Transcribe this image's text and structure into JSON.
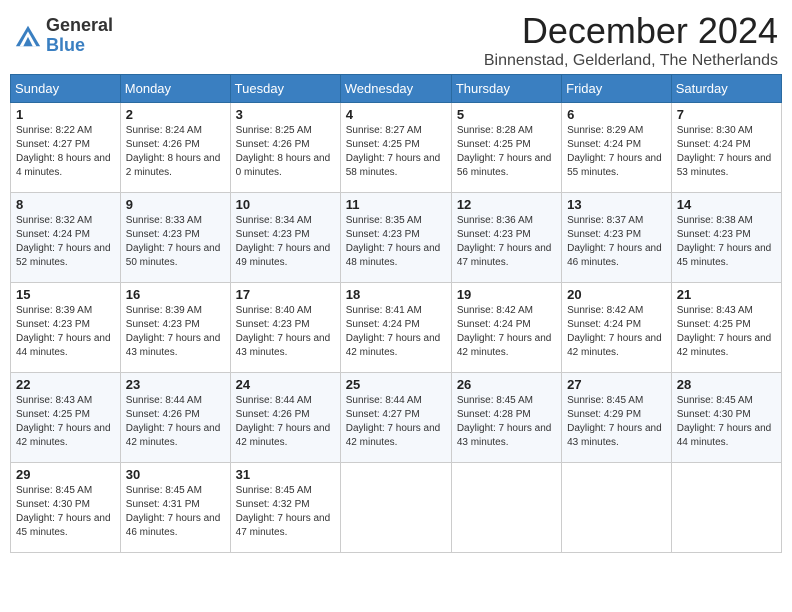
{
  "header": {
    "logo_general": "General",
    "logo_blue": "Blue",
    "month_title": "December 2024",
    "location": "Binnenstad, Gelderland, The Netherlands"
  },
  "days_of_week": [
    "Sunday",
    "Monday",
    "Tuesday",
    "Wednesday",
    "Thursday",
    "Friday",
    "Saturday"
  ],
  "weeks": [
    [
      {
        "day": 1,
        "sunrise": "8:22 AM",
        "sunset": "4:27 PM",
        "daylight": "8 hours and 4 minutes."
      },
      {
        "day": 2,
        "sunrise": "8:24 AM",
        "sunset": "4:26 PM",
        "daylight": "8 hours and 2 minutes."
      },
      {
        "day": 3,
        "sunrise": "8:25 AM",
        "sunset": "4:26 PM",
        "daylight": "8 hours and 0 minutes."
      },
      {
        "day": 4,
        "sunrise": "8:27 AM",
        "sunset": "4:25 PM",
        "daylight": "7 hours and 58 minutes."
      },
      {
        "day": 5,
        "sunrise": "8:28 AM",
        "sunset": "4:25 PM",
        "daylight": "7 hours and 56 minutes."
      },
      {
        "day": 6,
        "sunrise": "8:29 AM",
        "sunset": "4:24 PM",
        "daylight": "7 hours and 55 minutes."
      },
      {
        "day": 7,
        "sunrise": "8:30 AM",
        "sunset": "4:24 PM",
        "daylight": "7 hours and 53 minutes."
      }
    ],
    [
      {
        "day": 8,
        "sunrise": "8:32 AM",
        "sunset": "4:24 PM",
        "daylight": "7 hours and 52 minutes."
      },
      {
        "day": 9,
        "sunrise": "8:33 AM",
        "sunset": "4:23 PM",
        "daylight": "7 hours and 50 minutes."
      },
      {
        "day": 10,
        "sunrise": "8:34 AM",
        "sunset": "4:23 PM",
        "daylight": "7 hours and 49 minutes."
      },
      {
        "day": 11,
        "sunrise": "8:35 AM",
        "sunset": "4:23 PM",
        "daylight": "7 hours and 48 minutes."
      },
      {
        "day": 12,
        "sunrise": "8:36 AM",
        "sunset": "4:23 PM",
        "daylight": "7 hours and 47 minutes."
      },
      {
        "day": 13,
        "sunrise": "8:37 AM",
        "sunset": "4:23 PM",
        "daylight": "7 hours and 46 minutes."
      },
      {
        "day": 14,
        "sunrise": "8:38 AM",
        "sunset": "4:23 PM",
        "daylight": "7 hours and 45 minutes."
      }
    ],
    [
      {
        "day": 15,
        "sunrise": "8:39 AM",
        "sunset": "4:23 PM",
        "daylight": "7 hours and 44 minutes."
      },
      {
        "day": 16,
        "sunrise": "8:39 AM",
        "sunset": "4:23 PM",
        "daylight": "7 hours and 43 minutes."
      },
      {
        "day": 17,
        "sunrise": "8:40 AM",
        "sunset": "4:23 PM",
        "daylight": "7 hours and 43 minutes."
      },
      {
        "day": 18,
        "sunrise": "8:41 AM",
        "sunset": "4:24 PM",
        "daylight": "7 hours and 42 minutes."
      },
      {
        "day": 19,
        "sunrise": "8:42 AM",
        "sunset": "4:24 PM",
        "daylight": "7 hours and 42 minutes."
      },
      {
        "day": 20,
        "sunrise": "8:42 AM",
        "sunset": "4:24 PM",
        "daylight": "7 hours and 42 minutes."
      },
      {
        "day": 21,
        "sunrise": "8:43 AM",
        "sunset": "4:25 PM",
        "daylight": "7 hours and 42 minutes."
      }
    ],
    [
      {
        "day": 22,
        "sunrise": "8:43 AM",
        "sunset": "4:25 PM",
        "daylight": "7 hours and 42 minutes."
      },
      {
        "day": 23,
        "sunrise": "8:44 AM",
        "sunset": "4:26 PM",
        "daylight": "7 hours and 42 minutes."
      },
      {
        "day": 24,
        "sunrise": "8:44 AM",
        "sunset": "4:26 PM",
        "daylight": "7 hours and 42 minutes."
      },
      {
        "day": 25,
        "sunrise": "8:44 AM",
        "sunset": "4:27 PM",
        "daylight": "7 hours and 42 minutes."
      },
      {
        "day": 26,
        "sunrise": "8:45 AM",
        "sunset": "4:28 PM",
        "daylight": "7 hours and 43 minutes."
      },
      {
        "day": 27,
        "sunrise": "8:45 AM",
        "sunset": "4:29 PM",
        "daylight": "7 hours and 43 minutes."
      },
      {
        "day": 28,
        "sunrise": "8:45 AM",
        "sunset": "4:30 PM",
        "daylight": "7 hours and 44 minutes."
      }
    ],
    [
      {
        "day": 29,
        "sunrise": "8:45 AM",
        "sunset": "4:30 PM",
        "daylight": "7 hours and 45 minutes."
      },
      {
        "day": 30,
        "sunrise": "8:45 AM",
        "sunset": "4:31 PM",
        "daylight": "7 hours and 46 minutes."
      },
      {
        "day": 31,
        "sunrise": "8:45 AM",
        "sunset": "4:32 PM",
        "daylight": "7 hours and 47 minutes."
      },
      null,
      null,
      null,
      null
    ]
  ]
}
